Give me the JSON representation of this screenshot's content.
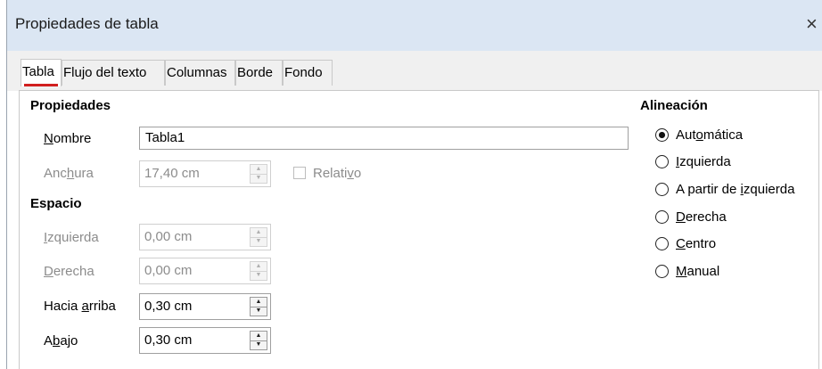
{
  "dialog": {
    "title": "Propiedades de tabla",
    "close_glyph": "×"
  },
  "tabs": [
    {
      "label": "Tabla",
      "active": true
    },
    {
      "label": "Flujo del texto",
      "active": false
    },
    {
      "label": "Columnas",
      "active": false
    },
    {
      "label": "Borde",
      "active": false
    },
    {
      "label": "Fondo",
      "active": false
    }
  ],
  "propiedades": {
    "heading": "Propiedades",
    "nombre": {
      "label_pre": "",
      "label_key": "N",
      "label_post": "ombre",
      "value": "Tabla1"
    },
    "anchura": {
      "label_pre": "Anc",
      "label_key": "h",
      "label_post": "ura",
      "value": "17,40 cm",
      "enabled": false
    },
    "relativo": {
      "label_pre": "Relati",
      "label_key": "v",
      "label_post": "o",
      "checked": false,
      "enabled": false
    }
  },
  "espacio": {
    "heading": "Espacio",
    "izquierda": {
      "label_pre": "",
      "label_key": "I",
      "label_post": "zquierda",
      "value": "0,00 cm",
      "enabled": false
    },
    "derecha": {
      "label_pre": "",
      "label_key": "D",
      "label_post": "erecha",
      "value": "0,00 cm",
      "enabled": false
    },
    "hacia_arriba": {
      "label_pre": "Hacia ",
      "label_key": "a",
      "label_post": "rriba",
      "value": "0,30 cm",
      "enabled": true
    },
    "abajo": {
      "label_pre": "A",
      "label_key": "b",
      "label_post": "ajo",
      "value": "0,30 cm",
      "enabled": true
    }
  },
  "alineacion": {
    "heading": "Alineación",
    "options": [
      {
        "label_pre": "Aut",
        "label_key": "o",
        "label_post": "mática",
        "selected": true
      },
      {
        "label_pre": "",
        "label_key": "I",
        "label_post": "zquierda",
        "selected": false
      },
      {
        "label_pre": "A partir de ",
        "label_key": "i",
        "label_post": "zquierda",
        "selected": false
      },
      {
        "label_pre": "",
        "label_key": "D",
        "label_post": "erecha",
        "selected": false
      },
      {
        "label_pre": "",
        "label_key": "C",
        "label_post": "entro",
        "selected": false
      },
      {
        "label_pre": "",
        "label_key": "M",
        "label_post": "anual",
        "selected": false
      }
    ]
  },
  "colors": {
    "titlebar_bg": "#dbe6f3",
    "active_tab_indicator": "#d11f1f",
    "disabled_text": "#8c8c8c"
  },
  "icons": {
    "close": "close-icon",
    "spin_up": "spin-up-arrow-icon",
    "spin_down": "spin-down-arrow-icon"
  }
}
